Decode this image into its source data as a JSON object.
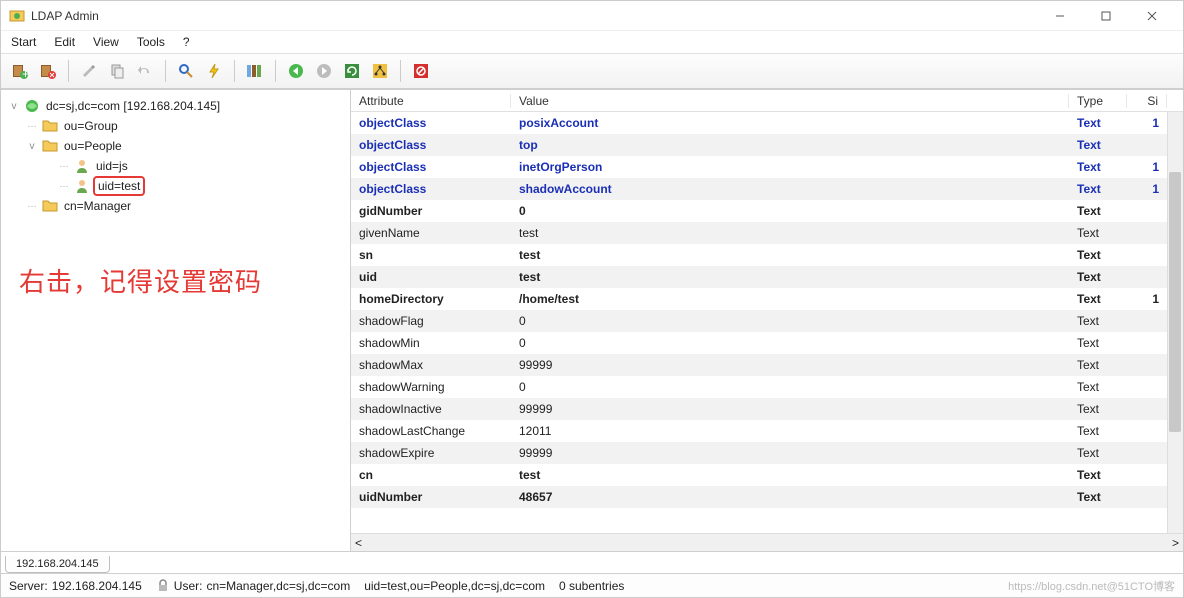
{
  "window": {
    "title": "LDAP Admin"
  },
  "menu": {
    "items": [
      "Start",
      "Edit",
      "View",
      "Tools",
      "?"
    ]
  },
  "toolbar_icons": [
    "book-add",
    "book-delete",
    "edit",
    "copy",
    "undo",
    "search",
    "bolt",
    "books",
    "back",
    "forward",
    "refresh",
    "tree",
    "stop"
  ],
  "tree": {
    "root": "dc=sj,dc=com [192.168.204.145]",
    "children": [
      {
        "label": "ou=Group",
        "icon": "folder"
      },
      {
        "label": "ou=People",
        "icon": "folder",
        "expanded": true,
        "children": [
          {
            "label": "uid=js",
            "icon": "user"
          },
          {
            "label": "uid=test",
            "icon": "user",
            "selected": true
          }
        ]
      },
      {
        "label": "cn=Manager",
        "icon": "folder"
      }
    ]
  },
  "annotation_text": "右击，记得设置密码",
  "grid": {
    "headers": {
      "attribute": "Attribute",
      "value": "Value",
      "type": "Type",
      "size": "Si"
    },
    "rows": [
      {
        "attr": "objectClass",
        "val": "posixAccount",
        "type": "Text",
        "size": "1",
        "bold": true,
        "blue": true
      },
      {
        "attr": "objectClass",
        "val": "top",
        "type": "Text",
        "size": "",
        "bold": true,
        "blue": true,
        "alt": true
      },
      {
        "attr": "objectClass",
        "val": "inetOrgPerson",
        "type": "Text",
        "size": "1",
        "bold": true,
        "blue": true
      },
      {
        "attr": "objectClass",
        "val": "shadowAccount",
        "type": "Text",
        "size": "1",
        "bold": true,
        "blue": true,
        "alt": true
      },
      {
        "attr": "gidNumber",
        "val": "0",
        "type": "Text",
        "size": "",
        "bold": true
      },
      {
        "attr": "givenName",
        "val": "test",
        "type": "Text",
        "size": "",
        "alt": true
      },
      {
        "attr": "sn",
        "val": "test",
        "type": "Text",
        "size": "",
        "bold": true
      },
      {
        "attr": "uid",
        "val": "test",
        "type": "Text",
        "size": "",
        "bold": true,
        "alt": true
      },
      {
        "attr": "homeDirectory",
        "val": "/home/test",
        "type": "Text",
        "size": "1",
        "bold": true
      },
      {
        "attr": "shadowFlag",
        "val": "0",
        "type": "Text",
        "size": "",
        "alt": true
      },
      {
        "attr": "shadowMin",
        "val": "0",
        "type": "Text",
        "size": ""
      },
      {
        "attr": "shadowMax",
        "val": "99999",
        "type": "Text",
        "size": "",
        "alt": true
      },
      {
        "attr": "shadowWarning",
        "val": "0",
        "type": "Text",
        "size": ""
      },
      {
        "attr": "shadowInactive",
        "val": "99999",
        "type": "Text",
        "size": "",
        "alt": true
      },
      {
        "attr": "shadowLastChange",
        "val": "12011",
        "type": "Text",
        "size": ""
      },
      {
        "attr": "shadowExpire",
        "val": "99999",
        "type": "Text",
        "size": "",
        "alt": true
      },
      {
        "attr": "cn",
        "val": "test",
        "type": "Text",
        "size": "",
        "bold": true
      },
      {
        "attr": "uidNumber",
        "val": "48657",
        "type": "Text",
        "size": "",
        "bold": true,
        "alt": true
      }
    ]
  },
  "bottom_tab": "192.168.204.145",
  "status": {
    "server_label": "Server:",
    "server": "192.168.204.145",
    "user_label": "User:",
    "user": "cn=Manager,dc=sj,dc=com",
    "dn": "uid=test,ou=People,dc=sj,dc=com",
    "subentries": "0 subentries",
    "watermark": "https://blog.csdn.net@51CTO博客"
  }
}
